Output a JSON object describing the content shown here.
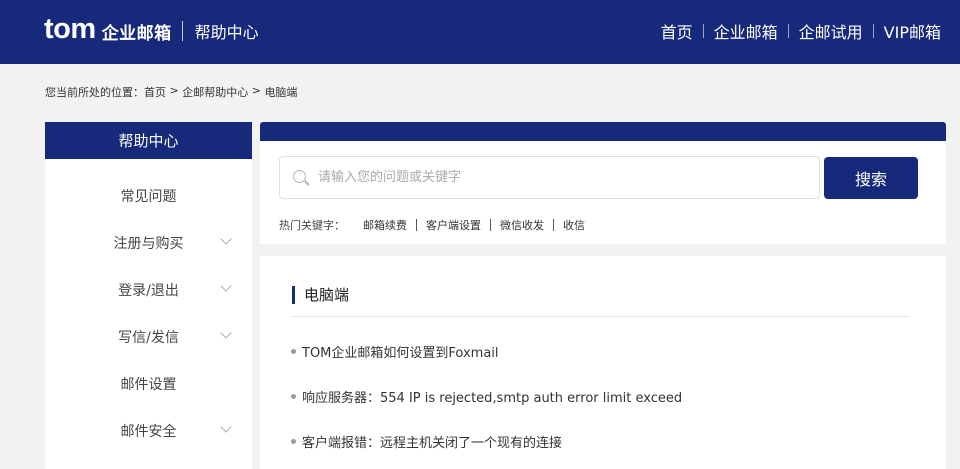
{
  "header": {
    "logo_brand": "tom",
    "logo_name": "企业邮箱",
    "logo_sub": "帮助中心",
    "nav": [
      "首页",
      "企业邮箱",
      "企邮试用",
      "VIP邮箱"
    ]
  },
  "breadcrumb": {
    "prefix": "您当前所处的位置：",
    "items": [
      "首页",
      "企邮帮助中心",
      "电脑端"
    ],
    "separator": " > "
  },
  "sidebar": {
    "title": "帮助中心",
    "items": [
      {
        "label": "常见问题",
        "has_submenu": false
      },
      {
        "label": "注册与购买",
        "has_submenu": true
      },
      {
        "label": "登录/退出",
        "has_submenu": true
      },
      {
        "label": "写信/发信",
        "has_submenu": true
      },
      {
        "label": "邮件设置",
        "has_submenu": false
      },
      {
        "label": "邮件安全",
        "has_submenu": true
      }
    ]
  },
  "search": {
    "placeholder": "请输入您的问题或关键字",
    "value": "",
    "button": "搜索",
    "hot_label": "热门关键字：",
    "hot_keywords": [
      "邮箱续费",
      "客户端设置",
      "微信收发",
      "收信"
    ]
  },
  "section": {
    "title": "电脑端",
    "articles": [
      "TOM企业邮箱如何设置到Foxmail",
      "响应服务器：554 IP is rejected,smtp auth error limit exceed",
      "客户端报错：远程主机关闭了一个现有的连接"
    ]
  },
  "colors": {
    "brand": "#17297a",
    "background": "#f2f2f2"
  },
  "icons": [
    "search-icon",
    "chevron-down-icon",
    "bullet-icon"
  ]
}
